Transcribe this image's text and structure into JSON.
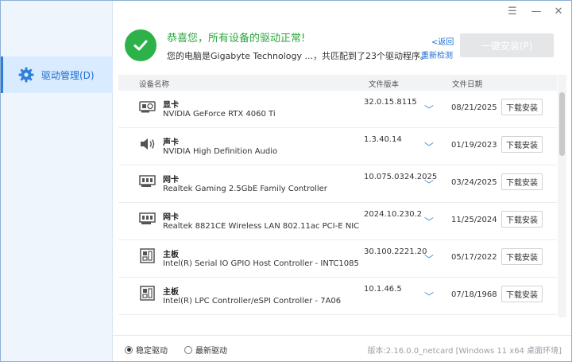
{
  "window": {
    "menu_glyph": "☰",
    "minimize_glyph": "—",
    "close_glyph": "✕"
  },
  "sidebar": {
    "items": [
      {
        "label": "驱动管理(D)",
        "icon": "gear-icon"
      }
    ]
  },
  "header": {
    "title": "恭喜您，所有设备的驱动正常!",
    "subtitle": "您的电脑是Gigabyte Technology ...，共匹配到了23个驱动程序。",
    "back_link": "<返回",
    "redetect_link": "重新检测",
    "install_button": "一键安装(P)",
    "status_color": "#2db24a"
  },
  "table": {
    "headers": {
      "name": "设备名称",
      "version": "文件版本",
      "date": "文件日期"
    },
    "download_label": "下载安装",
    "rows": [
      {
        "icon": "gpu-icon",
        "category": "显卡",
        "name": "NVIDIA GeForce RTX 4060 Ti",
        "version": "32.0.15.8115",
        "date": "08/21/2025"
      },
      {
        "icon": "speaker-icon",
        "category": "声卡",
        "name": "NVIDIA High Definition Audio",
        "version": "1.3.40.14",
        "date": "01/19/2023"
      },
      {
        "icon": "network-card-icon",
        "category": "网卡",
        "name": "Realtek Gaming 2.5GbE Family Controller",
        "version": "10.075.0324.2025",
        "date": "03/24/2025"
      },
      {
        "icon": "network-card-icon",
        "category": "网卡",
        "name": "Realtek 8821CE Wireless LAN 802.11ac PCI-E NIC",
        "version": "2024.10.230.2",
        "date": "11/25/2024"
      },
      {
        "icon": "motherboard-icon",
        "category": "主板",
        "name": "Intel(R) Serial IO GPIO Host Controller - INTC1085",
        "version": "30.100.2221.20",
        "date": "05/17/2022"
      },
      {
        "icon": "motherboard-icon",
        "category": "主板",
        "name": "Intel(R) LPC Controller/eSPI Controller - 7A06",
        "version": "10.1.46.5",
        "date": "07/18/1968"
      }
    ]
  },
  "footer": {
    "radio_stable": "稳定驱动",
    "radio_latest": "最新驱动",
    "selected": "stable",
    "version": "版本:2.16.0.0_netcard [Windows 11 x64 桌面环境]"
  }
}
